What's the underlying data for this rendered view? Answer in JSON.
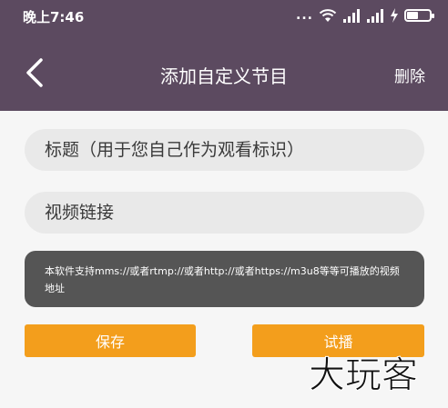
{
  "status_bar": {
    "time": "晚上7:46",
    "dots": "...",
    "icons": [
      "wifi-icon",
      "signal-icon",
      "signal-icon",
      "charging-icon",
      "battery-icon"
    ],
    "battery_level": 0.5
  },
  "header": {
    "title": "添加自定义节目",
    "back_icon": "chevron-left-icon",
    "delete_label": "删除",
    "background": "#5c4a60"
  },
  "form": {
    "title_placeholder": "标题（用于您自己作为观看标识）",
    "link_placeholder": "视频链接"
  },
  "tip": {
    "text": "本软件支持mms://或者rtmp://或者http://或者https://m3u8等等可播放的视频地址"
  },
  "actions": {
    "save_label": "保存",
    "preview_label": "试播",
    "accent": "#f39e1c"
  },
  "watermark": {
    "text": "大玩客"
  }
}
